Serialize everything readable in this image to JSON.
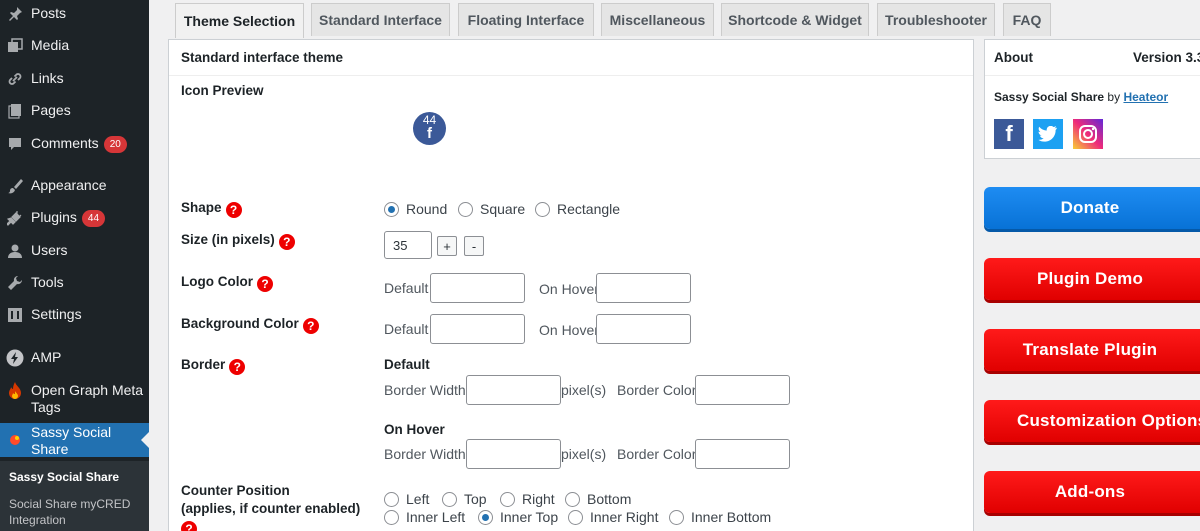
{
  "sidebar": {
    "items": [
      {
        "label": "Posts",
        "icon": "pin-icon"
      },
      {
        "label": "Media",
        "icon": "media-icon"
      },
      {
        "label": "Links",
        "icon": "link-icon"
      },
      {
        "label": "Pages",
        "icon": "pages-icon"
      },
      {
        "label": "Comments",
        "icon": "comment-icon",
        "badge": "20"
      },
      {
        "label": "Appearance",
        "icon": "brush-icon"
      },
      {
        "label": "Plugins",
        "icon": "plug-icon",
        "badge": "44"
      },
      {
        "label": "Users",
        "icon": "user-icon"
      },
      {
        "label": "Tools",
        "icon": "wrench-icon"
      },
      {
        "label": "Settings",
        "icon": "settings-icon"
      },
      {
        "label": "AMP",
        "icon": "amp-icon"
      },
      {
        "label": "Open Graph Meta Tags",
        "icon": "flame-icon"
      },
      {
        "label": "Sassy Social Share",
        "icon": "sassy-icon"
      }
    ],
    "submenu": [
      "Sassy Social Share",
      "Social Share myCRED Integration"
    ]
  },
  "tabs": [
    "Theme Selection",
    "Standard Interface",
    "Floating Interface",
    "Miscellaneous",
    "Shortcode & Widget",
    "Troubleshooter",
    "FAQ"
  ],
  "panel": {
    "title": "Standard interface theme",
    "icon_preview_label": "Icon Preview",
    "preview_count": "44",
    "preview_glyph": "f",
    "shape": {
      "label": "Shape",
      "options": [
        "Round",
        "Square",
        "Rectangle"
      ],
      "selected": "Round"
    },
    "size": {
      "label": "Size (in pixels)",
      "value": "35",
      "plus": "+",
      "minus": "-"
    },
    "logo_color": {
      "label": "Logo Color",
      "default_label": "Default",
      "hover_label": "On Hover"
    },
    "bg_color": {
      "label": "Background Color",
      "default_label": "Default",
      "hover_label": "On Hover"
    },
    "border": {
      "label": "Border",
      "default_heading": "Default",
      "hover_heading": "On Hover",
      "width_label": "Border Width",
      "unit": "pixel(s)",
      "color_label": "Border Color"
    },
    "counter": {
      "label_line1": "Counter Position",
      "label_line2": "(applies, if counter enabled)",
      "options_row1": [
        "Left",
        "Top",
        "Right",
        "Bottom"
      ],
      "options_row2": [
        "Inner Left",
        "Inner Top",
        "Inner Right",
        "Inner Bottom"
      ],
      "selected": "Inner Top"
    },
    "help_glyph": "?"
  },
  "about": {
    "title": "About",
    "version": "Version 3.3",
    "product": "Sassy Social Share",
    "by": "by",
    "author": "Heateor",
    "social": {
      "facebook": "f",
      "twitter": "t",
      "instagram": "ig"
    }
  },
  "side_buttons": [
    "Donate",
    "Plugin Demo",
    "Translate Plugin",
    "Customization Options",
    "Add-ons"
  ],
  "colors": {
    "sidebar": "#1d2327",
    "active": "#2271b1",
    "badge": "#d63638",
    "help": "#ee0000",
    "donate": "#0d7ee6",
    "red_button": "#ee0000",
    "facebook": "#3b5998",
    "twitter": "#1da1f2"
  }
}
